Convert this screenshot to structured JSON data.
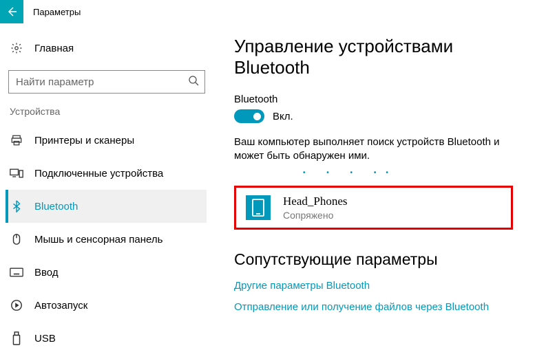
{
  "titlebar": {
    "title": "Параметры"
  },
  "sidebar": {
    "home": "Главная",
    "searchPlaceholder": "Найти параметр",
    "category": "Устройства",
    "items": [
      {
        "label": "Принтеры и сканеры"
      },
      {
        "label": "Подключенные устройства"
      },
      {
        "label": "Bluetooth"
      },
      {
        "label": "Мышь и сенсорная панель"
      },
      {
        "label": "Ввод"
      },
      {
        "label": "Автозапуск"
      },
      {
        "label": "USB"
      }
    ]
  },
  "main": {
    "heading": "Управление устройствами Bluetooth",
    "toggleLabel": "Bluetooth",
    "toggleState": "Вкл.",
    "description": "Ваш компьютер выполняет поиск устройств Bluetooth и может быть обнаружен ими.",
    "device": {
      "name": "Head_Phones",
      "status": "Сопряжено"
    },
    "related": {
      "heading": "Сопутствующие параметры",
      "links": [
        "Другие параметры Bluetooth",
        "Отправление или получение файлов через Bluetooth"
      ]
    }
  }
}
